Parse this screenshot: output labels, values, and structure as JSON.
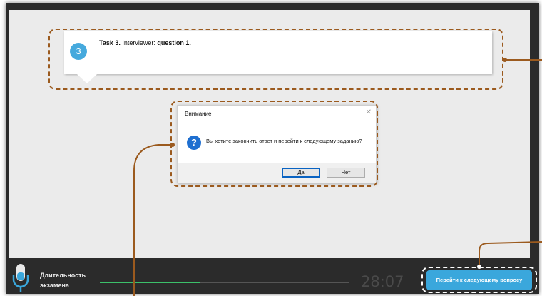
{
  "task": {
    "number": "3",
    "label": "Task 3.",
    "prefix": "Interviewer:",
    "question": "question 1."
  },
  "dialog": {
    "title": "Внимание",
    "close": "✕",
    "icon": "?",
    "message": "Вы хотите закончить ответ и перейти к следующему заданию?",
    "yes": "Да",
    "no": "Нет"
  },
  "footer": {
    "duration_line1": "Длительность",
    "duration_line2": "экзамена",
    "timer": "28:07",
    "progress_percent": 40,
    "next_button": "Перейти к следующему вопросу"
  },
  "colors": {
    "accent": "#3aa7dc",
    "callout": "#9b5a1e",
    "progress": "#3cc06a",
    "background": "#2b2b2b"
  }
}
